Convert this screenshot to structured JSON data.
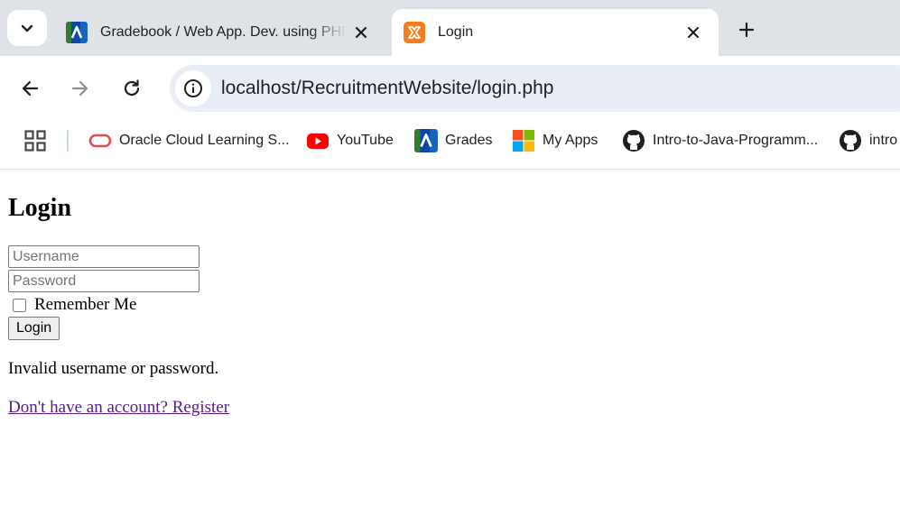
{
  "browser": {
    "tabs": [
      {
        "title": "Gradebook / Web App. Dev. using PHP",
        "favicon": "avenue-logo-icon",
        "active": false
      },
      {
        "title": "Login",
        "favicon": "xampp-logo-icon",
        "active": true
      }
    ],
    "address_bar": {
      "url": "localhost/RecruitmentWebsite/login.php"
    },
    "bookmarks": [
      {
        "label": "Oracle Cloud Learning S...",
        "icon": "oracle-icon"
      },
      {
        "label": "YouTube",
        "icon": "youtube-icon"
      },
      {
        "label": "Grades",
        "icon": "avenue-logo-icon"
      },
      {
        "label": "My Apps",
        "icon": "microsoft-icon"
      },
      {
        "label": "Intro-to-Java-Programm...",
        "icon": "github-icon"
      },
      {
        "label": "intro",
        "icon": "github-icon"
      }
    ]
  },
  "page": {
    "title": "Login",
    "username_placeholder": "Username",
    "password_placeholder": "Password",
    "remember_label": "Remember Me",
    "remember_checked": false,
    "login_button": "Login",
    "error_message": "Invalid username or password.",
    "register_link": "Don't have an account? Register"
  },
  "colors": {
    "tabstrip_bg": "#dfe3e8",
    "omnibox_bg": "#e9eef6",
    "visited_link": "#551a8b"
  }
}
